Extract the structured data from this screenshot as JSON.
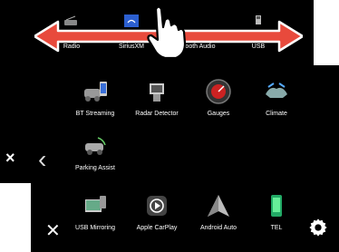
{
  "back_menu": {
    "sources": [
      "Radio",
      "SiriusXM",
      "Bluetooth Audio",
      "USB"
    ],
    "close_symbol": "×"
  },
  "front_menu": {
    "row1": [
      "BT Streaming",
      "Radar Detector",
      "Gauges",
      "Climate"
    ],
    "row2": [
      "Parking Assist"
    ],
    "row3": [
      "USB Mirroring",
      "Apple CarPlay",
      "Android Auto",
      "TEL"
    ],
    "left_arrow": "‹",
    "close_symbol": "✕"
  },
  "colors": {
    "arrow": "#e84a3c",
    "background": "#000000",
    "text": "#ffffff"
  },
  "icons": {
    "gesture": "pointing-hand-icon",
    "settings": "gear-icon"
  }
}
